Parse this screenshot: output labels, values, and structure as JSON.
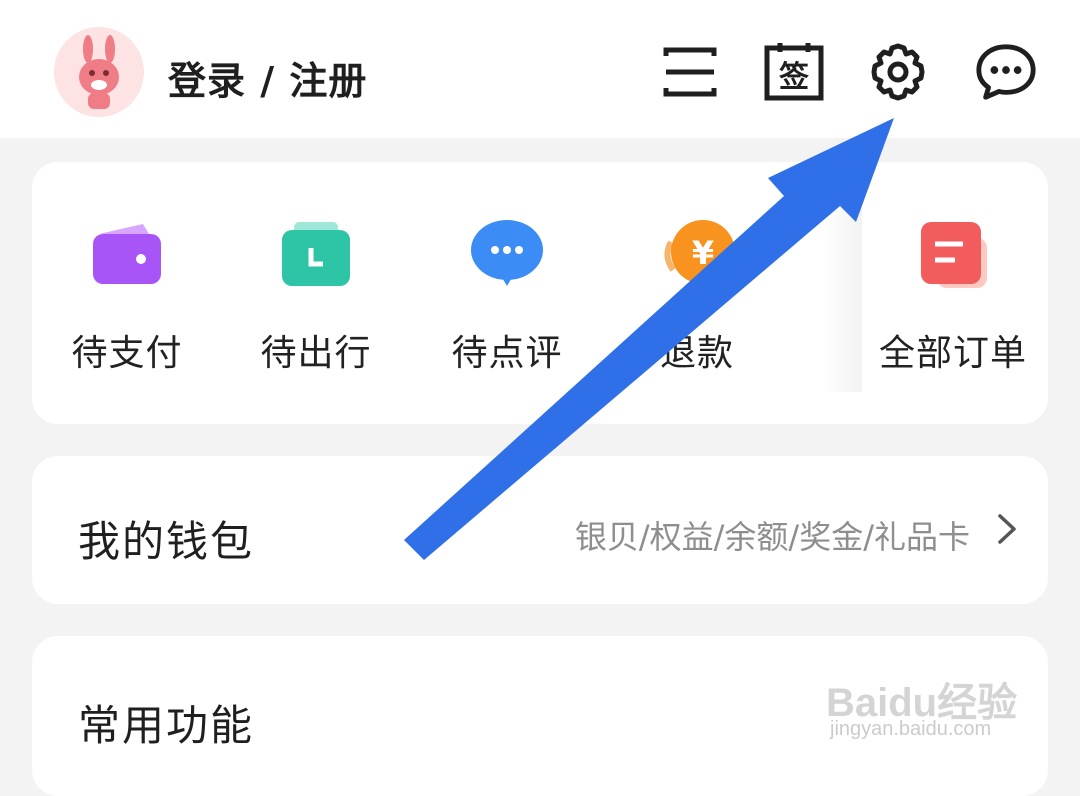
{
  "header": {
    "login_label": "登录 / 注册",
    "icons": [
      "scan-icon",
      "checkin-icon",
      "settings-icon",
      "message-icon"
    ],
    "checkin_glyph": "签"
  },
  "orders": {
    "items": [
      {
        "label": "待支付",
        "icon": "wallet-icon",
        "color": "#a855f7"
      },
      {
        "label": "待出行",
        "icon": "ticket-icon",
        "color": "#2ec4a6"
      },
      {
        "label": "待点评",
        "icon": "comment-icon",
        "color": "#3b8cf5"
      },
      {
        "label": "退款",
        "icon": "refund-icon",
        "color": "#f7931e"
      },
      {
        "label": "全部订单",
        "icon": "all-orders-icon",
        "color": "#f25c5c"
      }
    ],
    "refund_glyph": "¥"
  },
  "wallet": {
    "title": "我的钱包",
    "subtitle": "银贝/权益/余额/奖金/礼品卡"
  },
  "common": {
    "title": "常用功能"
  },
  "watermark": {
    "brand": "Baidu经验",
    "url": "jingyan.baidu.com"
  },
  "colors": {
    "arrow": "#2f6fe8",
    "background": "#f3f3f3"
  }
}
